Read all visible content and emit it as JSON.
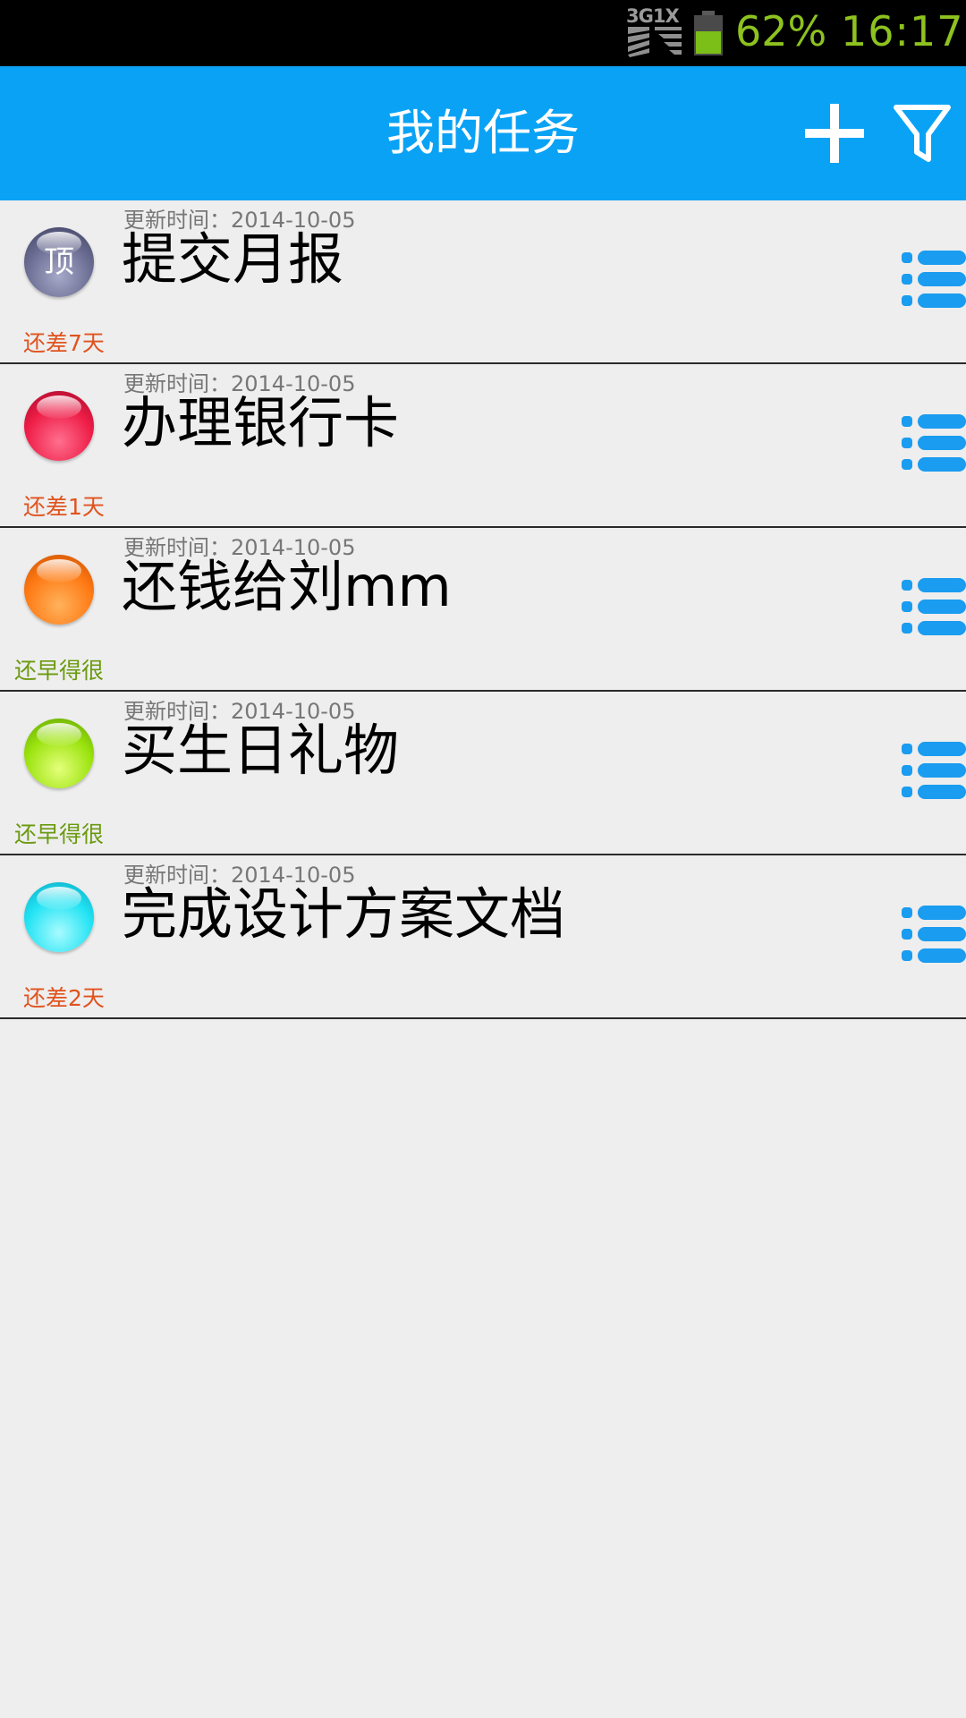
{
  "status_bar": {
    "network_label": "3G1X",
    "battery_percent": 62,
    "battery_text": "62%",
    "time": "16:17",
    "text_color": "#8dc21f"
  },
  "header": {
    "title": "我的任务",
    "add_icon": "plus-icon",
    "filter_icon": "filter-icon",
    "background": "#0aa2f5"
  },
  "tasks": [
    {
      "updated": "更新时间：2014-10-05",
      "title": "提交月报",
      "status": "还差7天",
      "status_type": "urgent",
      "orb_color": "gray",
      "orb_label": "顶"
    },
    {
      "updated": "更新时间：2014-10-05",
      "title": "办理银行卡",
      "status": "还差1天",
      "status_type": "urgent",
      "orb_color": "red"
    },
    {
      "updated": "更新时间：2014-10-05",
      "title": "还钱给刘mm",
      "status": "还早得很",
      "status_type": "ok",
      "orb_color": "orange"
    },
    {
      "updated": "更新时间：2014-10-05",
      "title": "买生日礼物",
      "status": "还早得很",
      "status_type": "ok",
      "orb_color": "green"
    },
    {
      "updated": "更新时间：2014-10-05",
      "title": "完成设计方案文档",
      "status": "还差2天",
      "status_type": "urgent",
      "orb_color": "cyan"
    }
  ],
  "colors": {
    "urgent": "#e0531e",
    "ok": "#6b9a10",
    "menu_icon": "#1a9cf0"
  }
}
